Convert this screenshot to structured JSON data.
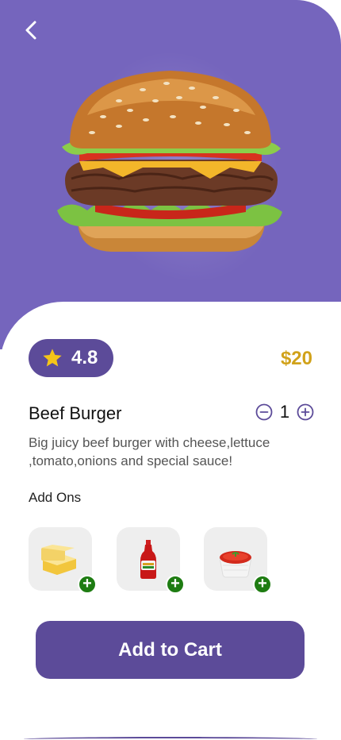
{
  "header": {
    "back_icon": "chevron-left-icon"
  },
  "product": {
    "image": "beef-burger-photo",
    "rating": "4.8",
    "price": "$20",
    "name": "Beef Burger",
    "quantity": "1",
    "description": "Big juicy beef burger with cheese,lettuce ,tomato,onions and special sauce!"
  },
  "addons": {
    "title": "Add Ons",
    "items": [
      {
        "name": "cheese",
        "plus": "+"
      },
      {
        "name": "ketchup-bottle",
        "plus": "+"
      },
      {
        "name": "salsa-bowl",
        "plus": "+"
      }
    ]
  },
  "cta": {
    "label": "Add to Cart"
  },
  "colors": {
    "primary": "#5c4b99",
    "hero_bg": "#7565bd",
    "price": "#d1a21a",
    "addon_badge": "#1e7c12",
    "star": "#f5c518"
  }
}
